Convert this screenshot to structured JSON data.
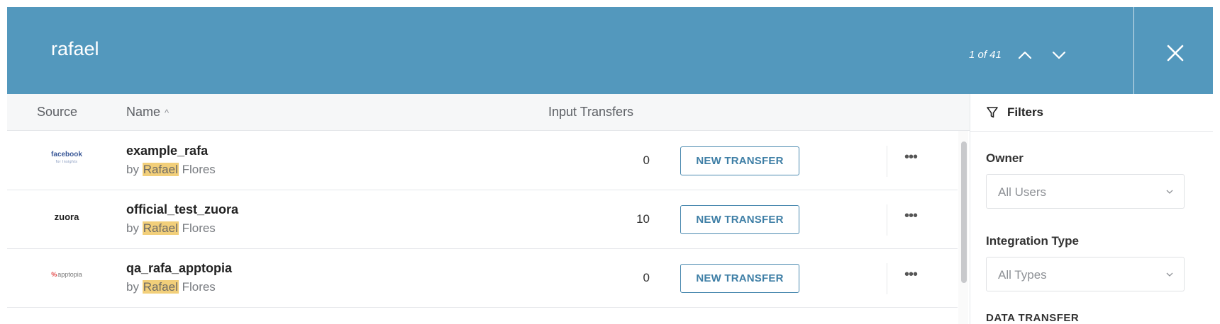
{
  "header": {
    "search_query": "rafael",
    "match_count": "1 of 41",
    "background_color": "#5398bd"
  },
  "table": {
    "columns": {
      "source": "Source",
      "name": "Name",
      "input_transfers": "Input Transfers"
    },
    "sort_indicator": "^",
    "rows": [
      {
        "source_logo": "facebook",
        "source_logo_sub": "for Insights",
        "name": "example_rafa",
        "owner_prefix": "by",
        "owner_highlight": "Rafael",
        "owner_rest": "Flores",
        "input_transfers": "0",
        "action_label": "NEW TRANSFER",
        "more_label": "•••"
      },
      {
        "source_logo": "zuora",
        "name": "official_test_zuora",
        "owner_prefix": "by",
        "owner_highlight": "Rafael",
        "owner_rest": "Flores",
        "input_transfers": "10",
        "action_label": "NEW TRANSFER",
        "more_label": "•••"
      },
      {
        "source_logo": "apptopia",
        "source_logo_mark": "%",
        "name": "qa_rafa_apptopia",
        "owner_prefix": "by",
        "owner_highlight": "Rafael",
        "owner_rest": "Flores",
        "input_transfers": "0",
        "action_label": "NEW TRANSFER",
        "more_label": "•••"
      }
    ]
  },
  "filters": {
    "title": "Filters",
    "owner_label": "Owner",
    "owner_value": "All Users",
    "integration_type_label": "Integration Type",
    "integration_type_value": "All Types",
    "data_transfer_label": "DATA TRANSFER"
  },
  "colors": {
    "accent": "#5398bd",
    "highlight": "#f2cf7a",
    "button_border": "#4b8ab0"
  }
}
